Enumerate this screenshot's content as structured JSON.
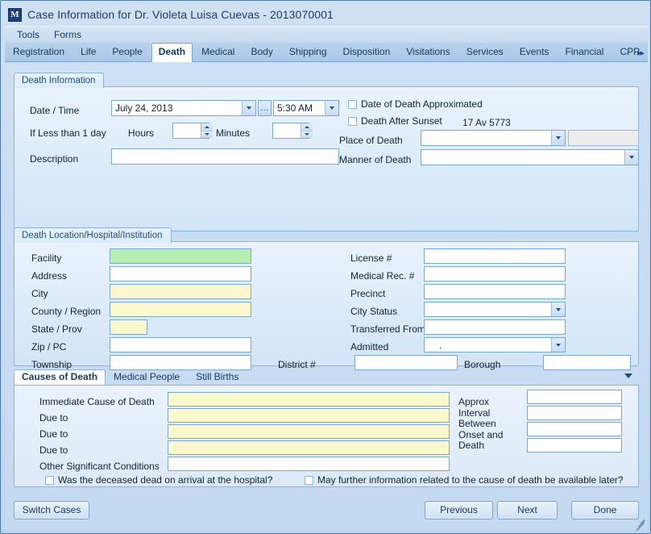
{
  "window": {
    "icon": "app-m-icon",
    "title": "Case Information for Dr. Violeta Luisa Cuevas - 2013070001"
  },
  "menubar": {
    "items": [
      {
        "label": "Tools"
      },
      {
        "label": "Forms"
      }
    ]
  },
  "tabstrip": {
    "tabs": [
      {
        "label": "Registration",
        "active": false
      },
      {
        "label": "Life",
        "active": false
      },
      {
        "label": "People",
        "active": false
      },
      {
        "label": "Death",
        "active": true
      },
      {
        "label": "Medical",
        "active": false
      },
      {
        "label": "Body",
        "active": false
      },
      {
        "label": "Shipping",
        "active": false
      },
      {
        "label": "Disposition",
        "active": false
      },
      {
        "label": "Visitations",
        "active": false
      },
      {
        "label": "Services",
        "active": false
      },
      {
        "label": "Events",
        "active": false
      },
      {
        "label": "Financial",
        "active": false
      },
      {
        "label": "CPP",
        "active": false
      }
    ],
    "overflow": "▸▸"
  },
  "death_information": {
    "title": "Death Information",
    "date_time_label": "Date / Time",
    "date_value": "July 24, 2013",
    "ellipsis_label": "...",
    "time_value": "5:30 AM",
    "if_less_than_label": "If Less than 1 day",
    "hours_label": "Hours",
    "hours_value": "",
    "minutes_label": "Minutes",
    "minutes_value": "",
    "description_label": "Description",
    "description_value": "",
    "date_approximated_label": "Date of Death Approximated",
    "death_after_sunset_label": "Death After Sunset",
    "hebrew_date": "17 Av 5773",
    "place_of_death_label": "Place of Death",
    "place_of_death_value": "",
    "place_of_death_secondary": "",
    "manner_of_death_label": "Manner of Death",
    "manner_of_death_value": ""
  },
  "death_location": {
    "title": "Death Location/Hospital/Institution",
    "left_fields": [
      {
        "label": "Facility",
        "value": "",
        "style": "green"
      },
      {
        "label": "Address",
        "value": "",
        "style": "white"
      },
      {
        "label": "City",
        "value": "",
        "style": "yellow"
      },
      {
        "label": "County / Region",
        "value": "",
        "style": "yellow"
      },
      {
        "label": "State / Prov",
        "value": "",
        "style": "yellow"
      },
      {
        "label": "Zip / PC",
        "value": "",
        "style": "white"
      },
      {
        "label": "Township",
        "value": "",
        "style": "white"
      }
    ],
    "right_fields": [
      {
        "label": "License #",
        "value": "",
        "type": "text"
      },
      {
        "label": "Medical Rec. #",
        "value": "",
        "type": "text"
      },
      {
        "label": "Precinct",
        "value": "",
        "type": "text"
      },
      {
        "label": "City Status",
        "value": "",
        "type": "combo"
      },
      {
        "label": "Transferred From",
        "value": "",
        "type": "text"
      },
      {
        "label": "Admitted",
        "value": ".",
        "type": "combo"
      }
    ],
    "district_label": "District #",
    "district_value": "",
    "borough_label": "Borough",
    "borough_value": ""
  },
  "causes_panel": {
    "tabs": [
      {
        "label": "Causes of Death",
        "active": true
      },
      {
        "label": "Medical People",
        "active": false
      },
      {
        "label": "Still Births",
        "active": false
      }
    ],
    "rows": [
      {
        "label": "Immediate Cause of Death",
        "value": "",
        "style": "yellow"
      },
      {
        "label": "Due to",
        "value": "",
        "style": "yellow"
      },
      {
        "label": "Due to",
        "value": "",
        "style": "yellow"
      },
      {
        "label": "Due to",
        "value": "",
        "style": "yellow"
      },
      {
        "label": "Other Significant Conditions",
        "value": "",
        "style": "white"
      }
    ],
    "interval_label_lines": [
      "Approx Interval",
      "Between",
      "Onset and",
      "Death"
    ],
    "interval_values": [
      "",
      "",
      "",
      ""
    ],
    "checkbox_doa": "Was the deceased dead on arrival at the hospital?",
    "checkbox_later": "May further information related to the cause of death be available later?"
  },
  "footer": {
    "switch_cases": "Switch Cases",
    "previous": "Previous",
    "next": "Next",
    "done": "Done"
  },
  "colors": {
    "accent": "#1d4f86",
    "field_required_yellow": "#fbf8cd",
    "field_highlight_green": "#b7eeb1",
    "window_frame": "#4d78a8"
  }
}
